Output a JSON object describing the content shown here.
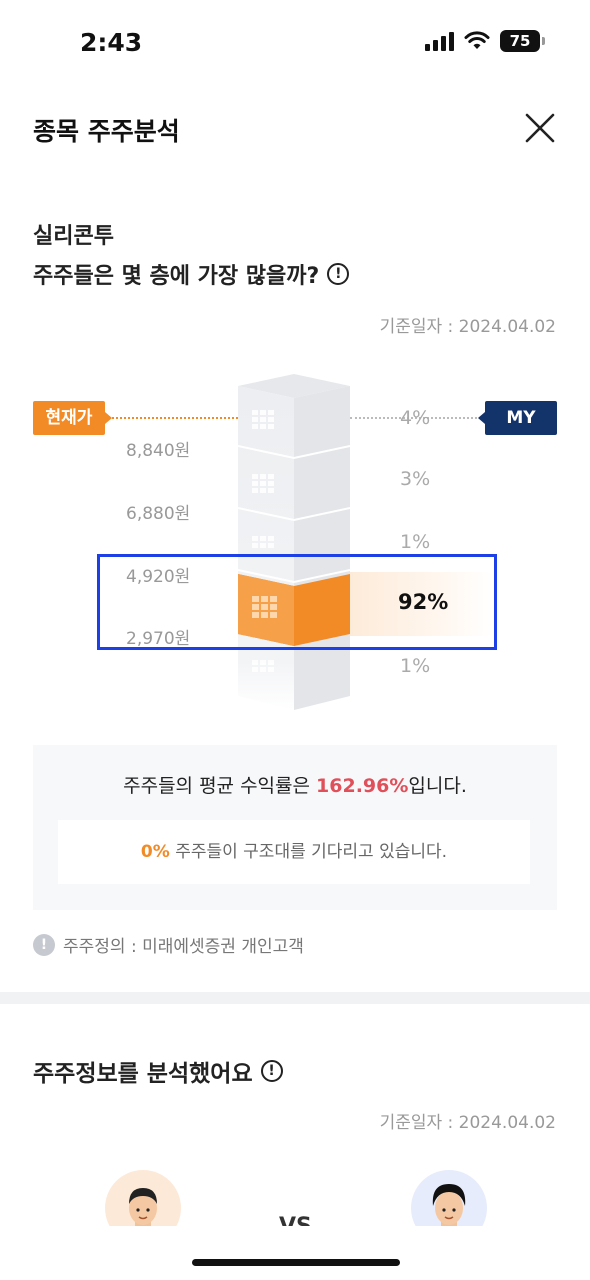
{
  "status_bar": {
    "time": "2:43",
    "battery": "75"
  },
  "header": {
    "title": "종목 주주분석",
    "close_icon": "close-icon"
  },
  "stock": {
    "name": "실리콘투"
  },
  "question": {
    "text": "주주들은 몇 층에 가장 많을까?",
    "icon": "info-icon"
  },
  "base_date": "기준일자 : 2024.04.02",
  "chart": {
    "current_price_label": "현재가",
    "my_label": "MY",
    "price_ticks": [
      "8,840원",
      "6,880원",
      "4,920원",
      "2,970원"
    ],
    "floors": [
      {
        "pct": "4%",
        "value": 4,
        "highlight": false
      },
      {
        "pct": "3%",
        "value": 3,
        "highlight": false
      },
      {
        "pct": "1%",
        "value": 1,
        "highlight": false
      },
      {
        "pct": "92%",
        "value": 92,
        "highlight": true
      },
      {
        "pct": "1%",
        "value": 1,
        "highlight": false
      }
    ],
    "colors": {
      "highlight": "#f28a26",
      "my": "#13336b",
      "selection": "#1c3fe6"
    }
  },
  "summary": {
    "line_prefix": "주주들의 평균 수익률은 ",
    "avg_return": "162.96%",
    "line_suffix": "입니다.",
    "rescue_pct": "0%",
    "rescue_text": " 주주들이 구조대를 기다리고 있습니다."
  },
  "definition": "주주정의 : 미래에셋증권 개인고객",
  "section2": {
    "title": "주주정보를 분석했어요",
    "base_date": "기준일자 : 2024.04.02",
    "vs": "VS"
  }
}
